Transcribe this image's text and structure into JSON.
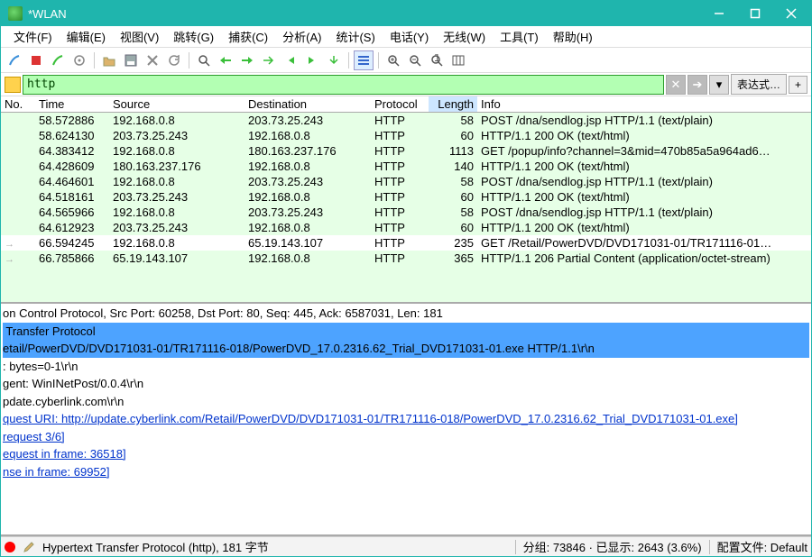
{
  "title": "*WLAN",
  "menu": [
    "文件(F)",
    "编辑(E)",
    "视图(V)",
    "跳转(G)",
    "捕获(C)",
    "分析(A)",
    "统计(S)",
    "电话(Y)",
    "无线(W)",
    "工具(T)",
    "帮助(H)"
  ],
  "filter": {
    "value": "http",
    "expr_label": "表达式…",
    "plus": "+"
  },
  "cols": {
    "no": "No.",
    "time": "Time",
    "src": "Source",
    "dst": "Destination",
    "proto": "Protocol",
    "len": "Length",
    "info": "Info"
  },
  "rows": [
    {
      "no": "",
      "time": "58.572886",
      "src": "192.168.0.8",
      "dst": "203.73.25.243",
      "proto": "HTTP",
      "len": "58",
      "info": "POST /dna/sendlog.jsp HTTP/1.1  (text/plain)"
    },
    {
      "no": "",
      "time": "58.624130",
      "src": "203.73.25.243",
      "dst": "192.168.0.8",
      "proto": "HTTP",
      "len": "60",
      "info": "HTTP/1.1 200 OK  (text/html)"
    },
    {
      "no": "",
      "time": "64.383412",
      "src": "192.168.0.8",
      "dst": "180.163.237.176",
      "proto": "HTTP",
      "len": "1113",
      "info": "GET /popup/info?channel=3&mid=470b85a5a964ad6…"
    },
    {
      "no": "",
      "time": "64.428609",
      "src": "180.163.237.176",
      "dst": "192.168.0.8",
      "proto": "HTTP",
      "len": "140",
      "info": "HTTP/1.1 200 OK  (text/html)"
    },
    {
      "no": "",
      "time": "64.464601",
      "src": "192.168.0.8",
      "dst": "203.73.25.243",
      "proto": "HTTP",
      "len": "58",
      "info": "POST /dna/sendlog.jsp HTTP/1.1  (text/plain)"
    },
    {
      "no": "",
      "time": "64.518161",
      "src": "203.73.25.243",
      "dst": "192.168.0.8",
      "proto": "HTTP",
      "len": "60",
      "info": "HTTP/1.1 200 OK  (text/html)"
    },
    {
      "no": "",
      "time": "64.565966",
      "src": "192.168.0.8",
      "dst": "203.73.25.243",
      "proto": "HTTP",
      "len": "58",
      "info": "POST /dna/sendlog.jsp HTTP/1.1  (text/plain)"
    },
    {
      "no": "",
      "time": "64.612923",
      "src": "203.73.25.243",
      "dst": "192.168.0.8",
      "proto": "HTTP",
      "len": "60",
      "info": "HTTP/1.1 200 OK  (text/html)"
    },
    {
      "no": "",
      "time": "66.594245",
      "src": "192.168.0.8",
      "dst": "65.19.143.107",
      "proto": "HTTP",
      "len": "235",
      "info": "GET /Retail/PowerDVD/DVD171031-01/TR171116-01…",
      "sel": true
    },
    {
      "no": "",
      "time": "66.785866",
      "src": "65.19.143.107",
      "dst": "192.168.0.8",
      "proto": "HTTP",
      "len": "365",
      "info": "HTTP/1.1 206 Partial Content  (application/octet-stream)"
    }
  ],
  "details": [
    {
      "t": "on Control Protocol, Src Port: 60258, Dst Port: 80, Seq: 445, Ack: 6587031, Len: 181"
    },
    {
      "t": " Transfer Protocol",
      "hl": true
    },
    {
      "t": "etail/PowerDVD/DVD171031-01/TR171116-018/PowerDVD_17.0.2316.62_Trial_DVD171031-01.exe HTTP/1.1\\r\\n",
      "hl": true
    },
    {
      "t": ": bytes=0-1\\r\\n"
    },
    {
      "t": "gent: WinINetPost/0.0.4\\r\\n"
    },
    {
      "t": "pdate.cyberlink.com\\r\\n"
    },
    {
      "t": ""
    },
    {
      "t": "quest URI: http://update.cyberlink.com/Retail/PowerDVD/DVD171031-01/TR171116-018/PowerDVD_17.0.2316.62_Trial_DVD171031-01.exe]",
      "link": true
    },
    {
      "t": "request 3/6]",
      "link": true
    },
    {
      "t": "equest in frame: 36518]",
      "link": true
    },
    {
      "t": "nse in frame: 69952]",
      "link": true
    }
  ],
  "status": {
    "proto": "Hypertext Transfer Protocol (http), 181 字节",
    "pkts": "分组: 73846 · 已显示: 2643 (3.6%)",
    "profile": "配置文件: Default"
  }
}
